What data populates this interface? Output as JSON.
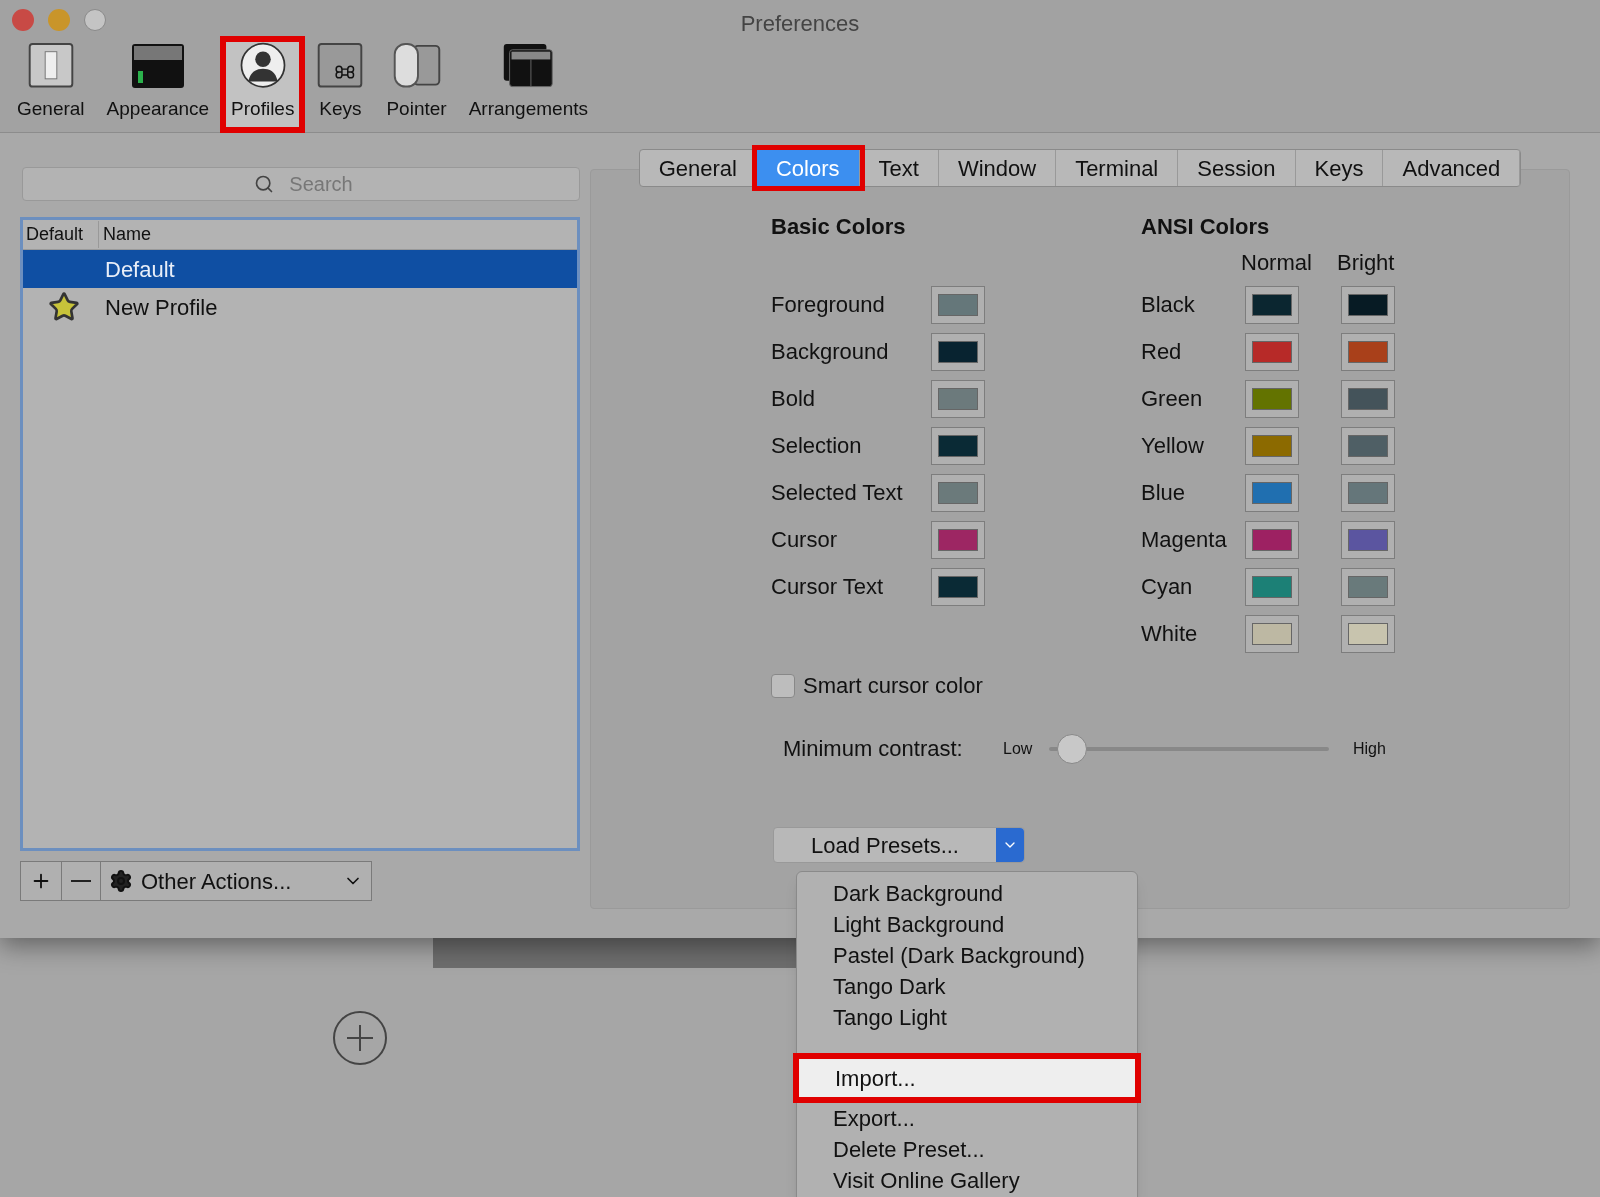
{
  "window": {
    "title": "Preferences"
  },
  "toolbar": [
    {
      "label": "General",
      "selected": false,
      "highlighted": false
    },
    {
      "label": "Appearance",
      "selected": false,
      "highlighted": false
    },
    {
      "label": "Profiles",
      "selected": true,
      "highlighted": true
    },
    {
      "label": "Keys",
      "selected": false,
      "highlighted": false
    },
    {
      "label": "Pointer",
      "selected": false,
      "highlighted": false
    },
    {
      "label": "Arrangements",
      "selected": false,
      "highlighted": false
    }
  ],
  "search": {
    "placeholder": "Search"
  },
  "profiles": {
    "columns": [
      "Default",
      "Name"
    ],
    "rows": [
      {
        "name": "Default",
        "default": false,
        "selected": true
      },
      {
        "name": "New Profile",
        "default": true,
        "selected": false
      }
    ]
  },
  "other_actions": "Other Actions...",
  "tabs": [
    {
      "label": "General",
      "selected": false,
      "highlighted": false
    },
    {
      "label": "Colors",
      "selected": true,
      "highlighted": true
    },
    {
      "label": "Text",
      "selected": false,
      "highlighted": false
    },
    {
      "label": "Window",
      "selected": false,
      "highlighted": false
    },
    {
      "label": "Terminal",
      "selected": false,
      "highlighted": false
    },
    {
      "label": "Session",
      "selected": false,
      "highlighted": false
    },
    {
      "label": "Keys",
      "selected": false,
      "highlighted": false
    },
    {
      "label": "Advanced",
      "selected": false,
      "highlighted": false
    }
  ],
  "basic_colors": {
    "title": "Basic Colors",
    "items": [
      {
        "label": "Foreground",
        "color": "#65777a"
      },
      {
        "label": "Background",
        "color": "#082330"
      },
      {
        "label": "Bold",
        "color": "#6c7a7c"
      },
      {
        "label": "Selection",
        "color": "#0a2a35"
      },
      {
        "label": "Selected Text",
        "color": "#6b7a7b"
      },
      {
        "label": "Cursor",
        "color": "#9d2663"
      },
      {
        "label": "Cursor Text",
        "color": "#0a2a35"
      }
    ]
  },
  "ansi_colors": {
    "title": "ANSI Colors",
    "normal_header": "Normal",
    "bright_header": "Bright",
    "items": [
      {
        "label": "Black",
        "swatches": [
          {
            "color": "#0b2630"
          },
          {
            "color": "#071b24"
          }
        ]
      },
      {
        "label": "Red",
        "swatches": [
          {
            "color": "#b72a28"
          },
          {
            "color": "#a9401a"
          }
        ]
      },
      {
        "label": "Green",
        "swatches": [
          {
            "color": "#637300"
          },
          {
            "color": "#44535a"
          }
        ]
      },
      {
        "label": "Yellow",
        "swatches": [
          {
            "color": "#8c6a00"
          },
          {
            "color": "#4f5f65"
          }
        ]
      },
      {
        "label": "Blue",
        "swatches": [
          {
            "color": "#206fb0"
          },
          {
            "color": "#65767a"
          }
        ]
      },
      {
        "label": "Magenta",
        "swatches": [
          {
            "color": "#9d2162"
          },
          {
            "color": "#5b55a0"
          }
        ]
      },
      {
        "label": "Cyan",
        "swatches": [
          {
            "color": "#1c8076"
          },
          {
            "color": "#697a7b"
          }
        ]
      },
      {
        "label": "White",
        "swatches": [
          {
            "color": "#bdb8a3"
          },
          {
            "color": "#c8c4ae"
          }
        ]
      }
    ]
  },
  "smart_cursor": {
    "label": "Smart cursor color",
    "checked": false
  },
  "contrast": {
    "label": "Minimum contrast:",
    "low": "Low",
    "high": "High",
    "level": 0.03
  },
  "load_presets": {
    "label": "Load Presets...",
    "menu": [
      {
        "label": "Dark Background",
        "kind": "item",
        "highlighted": false
      },
      {
        "label": "Light Background",
        "kind": "item",
        "highlighted": false
      },
      {
        "label": "Pastel (Dark Background)",
        "kind": "item",
        "highlighted": false
      },
      {
        "label": "Tango Dark",
        "kind": "item",
        "highlighted": false
      },
      {
        "label": "Tango Light",
        "kind": "item",
        "highlighted": false
      },
      {
        "kind": "separator"
      },
      {
        "label": "Import...",
        "kind": "item",
        "highlighted": true
      },
      {
        "label": "Export...",
        "kind": "item",
        "highlighted": false
      },
      {
        "label": "Delete Preset...",
        "kind": "item",
        "highlighted": false
      },
      {
        "label": "Visit Online Gallery",
        "kind": "item",
        "highlighted": false
      }
    ]
  }
}
